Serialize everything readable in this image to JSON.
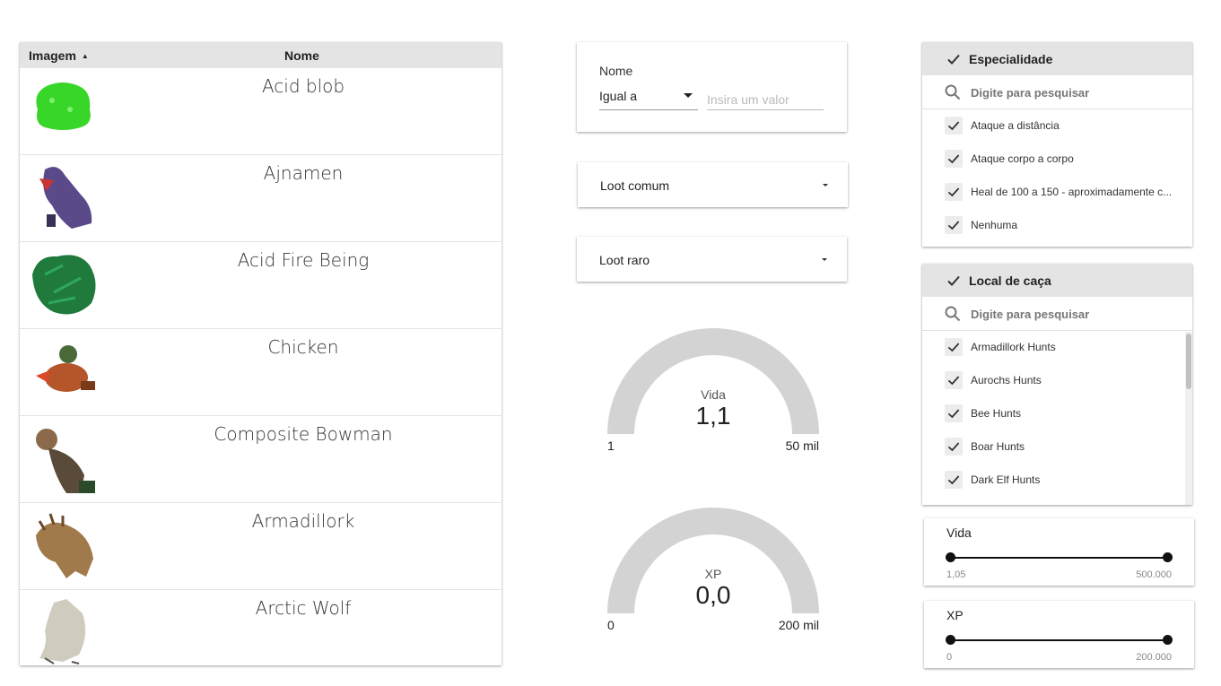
{
  "table": {
    "columns": {
      "image": "Imagem",
      "name": "Nome"
    },
    "rows": [
      {
        "name": "Acid blob",
        "icon": "acid-blob-sprite",
        "color": "#39d62a"
      },
      {
        "name": "Ajnamen",
        "icon": "ajnamen-sprite",
        "color": "#5a4a8a"
      },
      {
        "name": "Acid Fire Being",
        "icon": "acid-fire-being-sprite",
        "color": "#1f7a3c"
      },
      {
        "name": "Chicken",
        "icon": "chicken-sprite",
        "color": "#b4552a"
      },
      {
        "name": "Composite Bowman",
        "icon": "composite-bowman-sprite",
        "color": "#5a4a3a"
      },
      {
        "name": "Armadillork",
        "icon": "armadillork-sprite",
        "color": "#a07a4a"
      },
      {
        "name": "Arctic Wolf",
        "icon": "arctic-wolf-sprite",
        "color": "#cfcbbf"
      }
    ]
  },
  "name_filter": {
    "label": "Nome",
    "operator": "Igual a",
    "placeholder": "Insira um valor",
    "value": ""
  },
  "loot_common": {
    "label": "Loot comum"
  },
  "loot_rare": {
    "label": "Loot raro"
  },
  "gauges": {
    "vida": {
      "label": "Vida",
      "value": "1,1",
      "min": "1",
      "max": "50 mil",
      "fill_fraction": 0
    },
    "xp": {
      "label": "XP",
      "value": "0,0",
      "min": "0",
      "max": "200 mil",
      "fill_fraction": 0
    }
  },
  "specialty": {
    "header": "Especialidade",
    "search_placeholder": "Digite para pesquisar",
    "items": [
      {
        "label": "Ataque a distância",
        "checked": true
      },
      {
        "label": "Ataque corpo a corpo",
        "checked": true
      },
      {
        "label": "Heal de 100 a 150 - aproximadamente c...",
        "checked": true
      },
      {
        "label": "Nenhuma",
        "checked": true
      }
    ]
  },
  "hunting": {
    "header": "Local de caça",
    "search_placeholder": "Digite para pesquisar",
    "items": [
      {
        "label": "Armadillork Hunts",
        "checked": true
      },
      {
        "label": "Aurochs Hunts",
        "checked": true
      },
      {
        "label": "Bee Hunts",
        "checked": true
      },
      {
        "label": "Boar Hunts",
        "checked": true
      },
      {
        "label": "Dark Elf Hunts",
        "checked": true
      }
    ]
  },
  "sliders": {
    "vida": {
      "title": "Vida",
      "min": "1,05",
      "max": "500.000"
    },
    "xp": {
      "title": "XP",
      "min": "0",
      "max": "200.000"
    }
  }
}
